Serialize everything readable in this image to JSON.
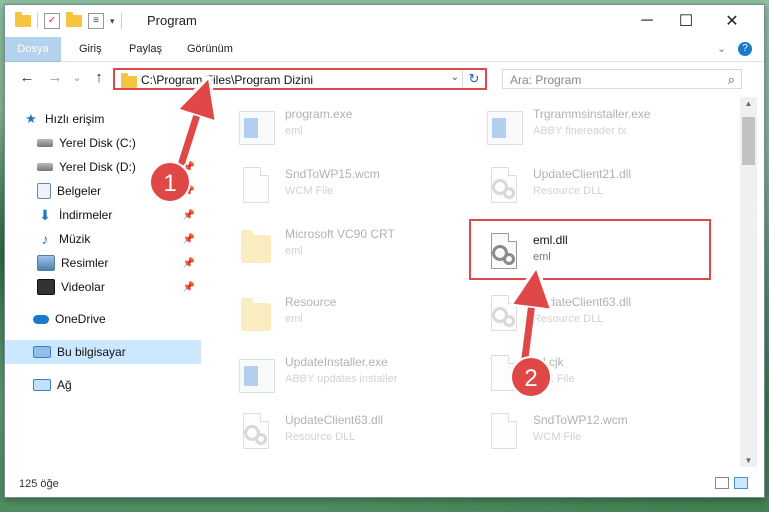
{
  "window": {
    "title": "Program",
    "controls": {
      "minimize": "─",
      "maximize": "☐",
      "close": "✕"
    }
  },
  "ribbon": {
    "tabs": [
      "Dosya",
      "Giriş",
      "Paylaş",
      "Görünüm"
    ]
  },
  "navigation": {
    "back": "←",
    "forward": "→",
    "recent": "⌄",
    "up": "↑",
    "address_path": "C:\\Program Files\\Program Dizini",
    "refresh": "↻",
    "search_placeholder": "Ara: Program",
    "search_icon": "⌕"
  },
  "sidebar": {
    "items": [
      {
        "label": "Hızlı erişim",
        "icon": "star-icon",
        "pinned": false
      },
      {
        "label": "Yerel Disk (C:)",
        "icon": "drive-icon",
        "pinned": true
      },
      {
        "label": "Yerel Disk (D:)",
        "icon": "drive-icon",
        "pinned": true
      },
      {
        "label": "Belgeler",
        "icon": "documents-icon",
        "pinned": true
      },
      {
        "label": "İndirmeler",
        "icon": "download-icon",
        "pinned": true
      },
      {
        "label": "Müzik",
        "icon": "music-icon",
        "pinned": true
      },
      {
        "label": "Resimler",
        "icon": "pictures-icon",
        "pinned": true
      },
      {
        "label": "Videolar",
        "icon": "videos-icon",
        "pinned": true
      },
      {
        "label": "OneDrive",
        "icon": "cloud-icon",
        "pinned": false
      },
      {
        "label": "Bu bilgisayar",
        "icon": "computer-icon",
        "pinned": false
      },
      {
        "label": "Ağ",
        "icon": "network-icon",
        "pinned": false
      }
    ],
    "pin_glyph": "📌"
  },
  "files": [
    {
      "name": "program.exe",
      "sub": "eml",
      "kind": "exe"
    },
    {
      "name": "Trgrammsinstaller.exe",
      "sub": "ABBY finereader tx",
      "kind": "exe"
    },
    {
      "name": "SndToWP15.wcm",
      "sub": "WCM File",
      "kind": "doc"
    },
    {
      "name": "UpdateClient21.dll",
      "sub": "Resource DLL",
      "kind": "dll"
    },
    {
      "name": "Microsoft VC90 CRT",
      "sub": "eml",
      "kind": "folder"
    },
    {
      "name": "eml.dll",
      "sub": "eml",
      "kind": "dll"
    },
    {
      "name": "Resource",
      "sub": "eml",
      "kind": "folder"
    },
    {
      "name": "UpdateClient63.dll",
      "sub": "Resource DLL",
      "kind": "dll"
    },
    {
      "name": "UpdateInstaller.exe",
      "sub": "ABBY updates installer",
      "kind": "exe"
    },
    {
      "name": "ltd.cjk",
      "sub": "CJK File",
      "kind": "doc"
    },
    {
      "name": "UpdateClient63.dll",
      "sub": "Resource DLL",
      "kind": "dll"
    },
    {
      "name": "SndToWP12.wcm",
      "sub": "WCM File",
      "kind": "doc"
    }
  ],
  "status": {
    "count": "125 öğe"
  },
  "callouts": [
    "1",
    "2"
  ],
  "colors": {
    "accent": "#1979ca",
    "highlight": "#e04848",
    "selection": "#cce8ff"
  }
}
